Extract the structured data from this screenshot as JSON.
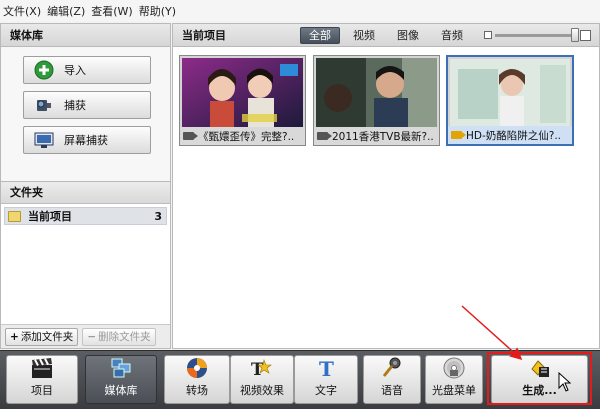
{
  "menu": [
    {
      "label": "文件(X)"
    },
    {
      "label": "编辑(Z)"
    },
    {
      "label": "查看(W)"
    },
    {
      "label": "帮助(Y)"
    }
  ],
  "left_panel": {
    "title": "媒体库",
    "buttons": [
      {
        "label": "导入",
        "icon": "plus-icon"
      },
      {
        "label": "捕获",
        "icon": "camcorder-icon"
      },
      {
        "label": "屏幕捕获",
        "icon": "screen-capture-icon"
      }
    ],
    "folder_title": "文件夹",
    "folders": [
      {
        "name": "当前项目",
        "count": "3"
      }
    ],
    "add_folder": "添加文件夹",
    "delete_folder": "删除文件夹"
  },
  "right_panel": {
    "title": "当前项目",
    "tabs": [
      {
        "label": "全部",
        "active": true
      },
      {
        "label": "视频"
      },
      {
        "label": "图像"
      },
      {
        "label": "音频"
      }
    ],
    "zoom_level": 1.0,
    "clips": [
      {
        "caption": "《甄嬛歪传》完整?..",
        "selected": false
      },
      {
        "caption": "2011香港TVB最新?..",
        "selected": false
      },
      {
        "caption": "HD-奶酪陷阱之仙?..",
        "selected": true
      }
    ]
  },
  "toolbar": {
    "buttons": [
      {
        "label": "项目",
        "icon": "clapperboard-icon"
      },
      {
        "label": "媒体库",
        "icon": "media-library-icon",
        "active": true
      },
      {
        "label": "转场",
        "icon": "transition-icon"
      },
      {
        "label": "视频效果",
        "icon": "fx-icon"
      },
      {
        "label": "文字",
        "icon": "text-icon"
      },
      {
        "label": "语音",
        "icon": "microphone-icon"
      },
      {
        "label": "光盘菜单",
        "icon": "disc-menu-icon"
      },
      {
        "label": "生成...",
        "icon": "produce-icon"
      }
    ]
  },
  "colors": {
    "highlight": "#e51b1b",
    "selection": "#3b6fb6",
    "toolbar_bg": "#45484c"
  }
}
